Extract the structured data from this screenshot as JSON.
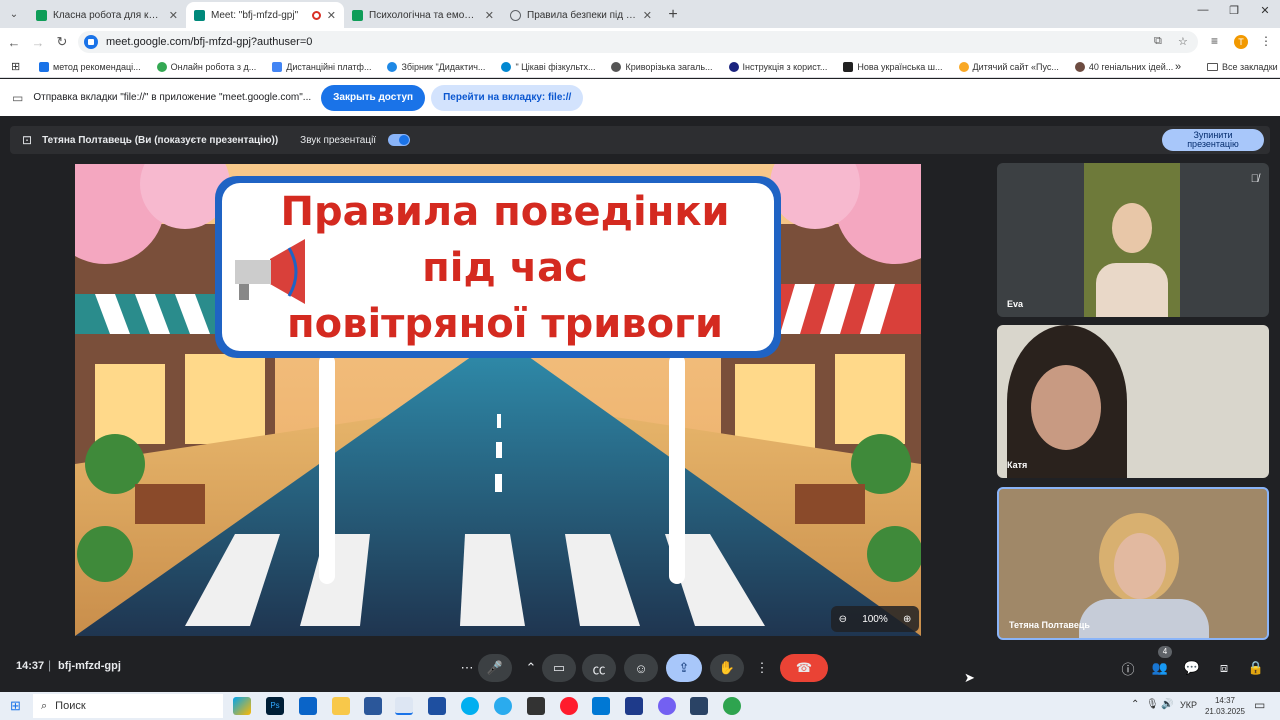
{
  "tabs": [
    {
      "label": "Класна робота для курсу \"Ви",
      "color": "#0f9d58",
      "active": false
    },
    {
      "label": "Meet: \"bfj-mfzd-gpj\"",
      "color": "#00897b",
      "active": true
    },
    {
      "label": "Психологічна та емоційна під",
      "color": "#0f9d58",
      "active": false
    },
    {
      "label": "Правила безпеки під час",
      "color": "#5f6368",
      "active": false
    }
  ],
  "address": {
    "url": "meet.google.com/bfj-mfzd-gpj?authuser=0"
  },
  "profile_initial": "Т",
  "bookmarks": [
    {
      "label": "метод рекомендаці...",
      "color": "#1a73e8"
    },
    {
      "label": "Онлайн робота з д...",
      "color": "#34a853"
    },
    {
      "label": "Дистанційні платф...",
      "color": "#4285f4"
    },
    {
      "label": "Збірник \"Дидактич...",
      "color": "#1e88e5"
    },
    {
      "label": "\" Цікаві фізкультх...",
      "color": "#0288d1"
    },
    {
      "label": "Криворізька загаль...",
      "color": "#555555"
    },
    {
      "label": "Інструкція з корист...",
      "color": "#1a237e"
    },
    {
      "label": "Нова українська ш...",
      "color": "#212121"
    },
    {
      "label": "Дитячий сайт «Пус...",
      "color": "#f9a825"
    },
    {
      "label": "40 геніальних ідей...",
      "color": "#6d4c41"
    }
  ],
  "bookmarks_all": "Все закладки",
  "infobar": {
    "text": "Отправка вкладки \"file://\" в приложение \"meet.google.com\"...",
    "close_access": "Закрыть доступ",
    "go_to_tab": "Перейти на вкладку: file://"
  },
  "presentation": {
    "presenter": "Тетяна Полтавець (Ви (показуєте презентацію))",
    "audio_label": "Звук презентації",
    "stop_line1": "Зупинити",
    "stop_line2": "презентацію"
  },
  "slide": {
    "line1": "Правила поведінки",
    "line2": "під час",
    "line3": "повітряної тривоги",
    "zoom": "100%"
  },
  "participants": [
    {
      "name": "Eva"
    },
    {
      "name": "Катя"
    },
    {
      "name": "Тетяна Полтавець"
    }
  ],
  "meeting": {
    "time": "14:37",
    "code": "bfj-mfzd-gpj",
    "people_count": "4"
  },
  "taskbar": {
    "search": "Поиск",
    "lang": "УКР",
    "time": "14:37",
    "date": "21.03.2025"
  }
}
